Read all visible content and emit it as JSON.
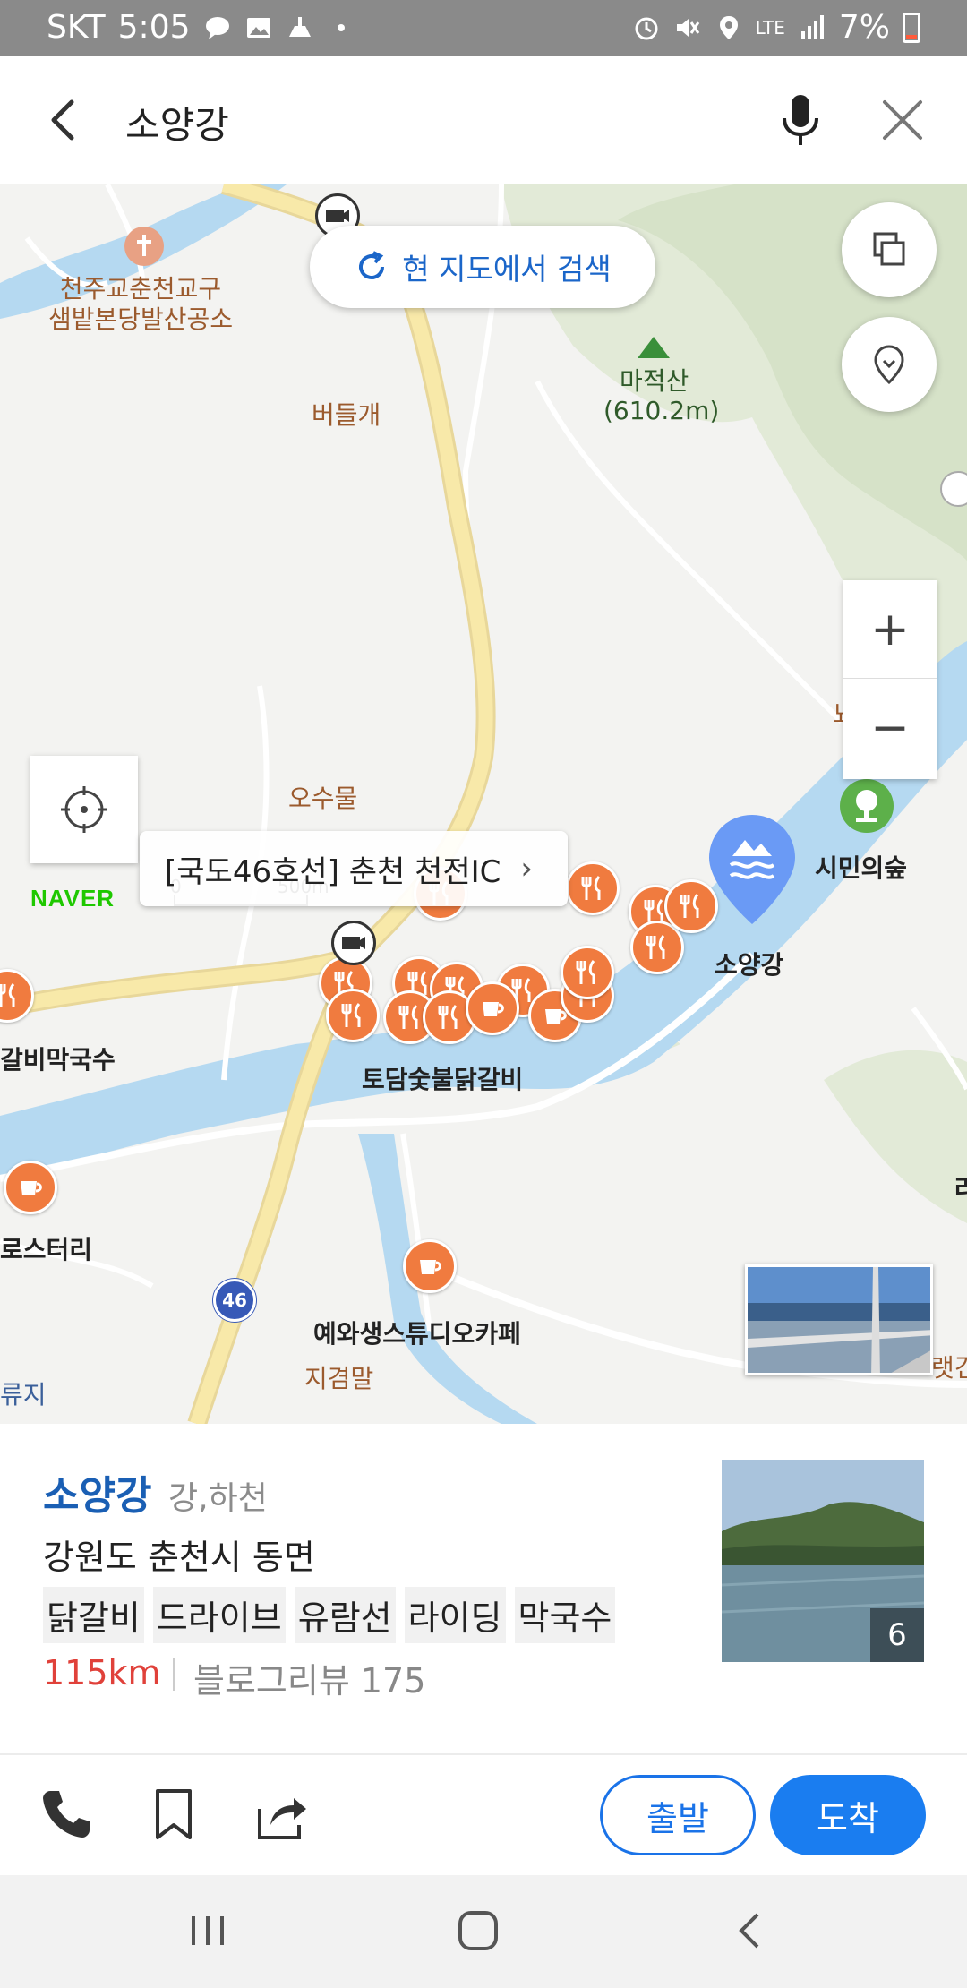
{
  "status_bar": {
    "carrier": "SKT",
    "time": "5:05",
    "network": "LTE",
    "battery": "7%"
  },
  "search": {
    "query": "소양강"
  },
  "map": {
    "search_here_label": "현 지도에서 검색",
    "road_tooltip": "[국도46호선] 춘천 천전IC",
    "road_sign": "46",
    "brand": "NAVER",
    "scale": {
      "start": "0",
      "end": "500m"
    },
    "labels": {
      "church": "천주교춘천교구\n샘밭본당발산공소",
      "mountain_name": "마적산",
      "mountain_elev": "(610.2m)",
      "poi_1": "버들개",
      "poi_2": "오수물",
      "poi_3": "지겸말",
      "forest": "시민의숲",
      "river_pin": "소양강",
      "restaurant_1": "토담숯불닭갈비",
      "restaurant_2": "갈비막국수",
      "cafe_1": "로스터리",
      "cafe_2": "예와생스튜디오카페",
      "edge_1": "류지",
      "edge_2": "랫건",
      "edge_3": "뇨",
      "edge_4": "라"
    }
  },
  "place": {
    "name": "소양강",
    "category": "강,하천",
    "address": "강원도 춘천시 동면",
    "tags": [
      "닭갈비",
      "드라이브",
      "유람선",
      "라이딩",
      "막국수"
    ],
    "distance": "115km",
    "blog_review": "블로그리뷰 175",
    "photo_count": "6"
  },
  "actions": {
    "depart": "출발",
    "arrive": "도착"
  },
  "colors": {
    "accent": "#1a73e8",
    "pin": "#f07b3f",
    "river": "#b5d9f1",
    "distance": "#e0413a"
  }
}
